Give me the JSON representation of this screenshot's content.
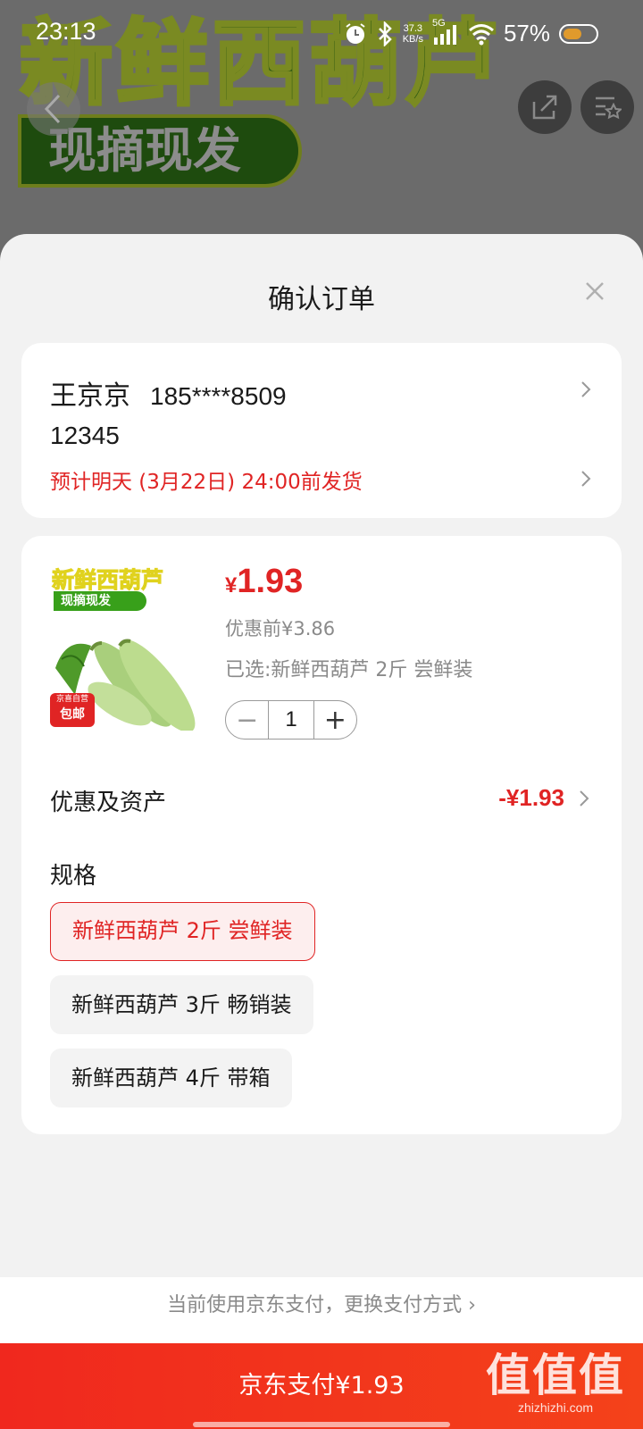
{
  "status_bar": {
    "time": "23:13",
    "speed_value": "37.3",
    "speed_unit": "KB/s",
    "network": "5G",
    "battery_percent": "57%"
  },
  "banner": {
    "title": "新鲜西葫芦",
    "subtitle": "现摘现发"
  },
  "sheet": {
    "title": "确认订单"
  },
  "address": {
    "name": "王京京",
    "phone": "185****8509",
    "line": "12345",
    "shipping": "预计明天 (3月22日) 24:00前发货"
  },
  "product": {
    "thumb_title": "新鲜西葫芦",
    "thumb_subtitle": "现摘现发",
    "thumb_badge_top": "京喜自营",
    "thumb_badge_bottom": "包邮",
    "price_currency": "¥",
    "price_amount": "1.93",
    "original_price": "优惠前¥3.86",
    "selected": "已选:新鲜西葫芦 2斤 尝鲜装",
    "quantity": "1",
    "minus_label": "−",
    "plus_label": "+"
  },
  "promotions": {
    "label": "优惠及资产",
    "value": "-¥1.93"
  },
  "spec": {
    "label": "规格",
    "options": [
      {
        "label": "新鲜西葫芦 2斤 尝鲜装",
        "selected": true
      },
      {
        "label": "新鲜西葫芦 3斤 畅销装",
        "selected": false
      },
      {
        "label": "新鲜西葫芦 4斤 带箱",
        "selected": false
      }
    ]
  },
  "payment": {
    "switch_text": "当前使用京东支付，更换支付方式 ›",
    "pay_button": "京东支付¥1.93"
  },
  "watermark": {
    "big": "值值值",
    "small": "zhizhizhi.com"
  },
  "colors": {
    "accent_red": "#e02424",
    "sheet_bg": "#f2f2f2",
    "pay_button": "#f0281e"
  }
}
